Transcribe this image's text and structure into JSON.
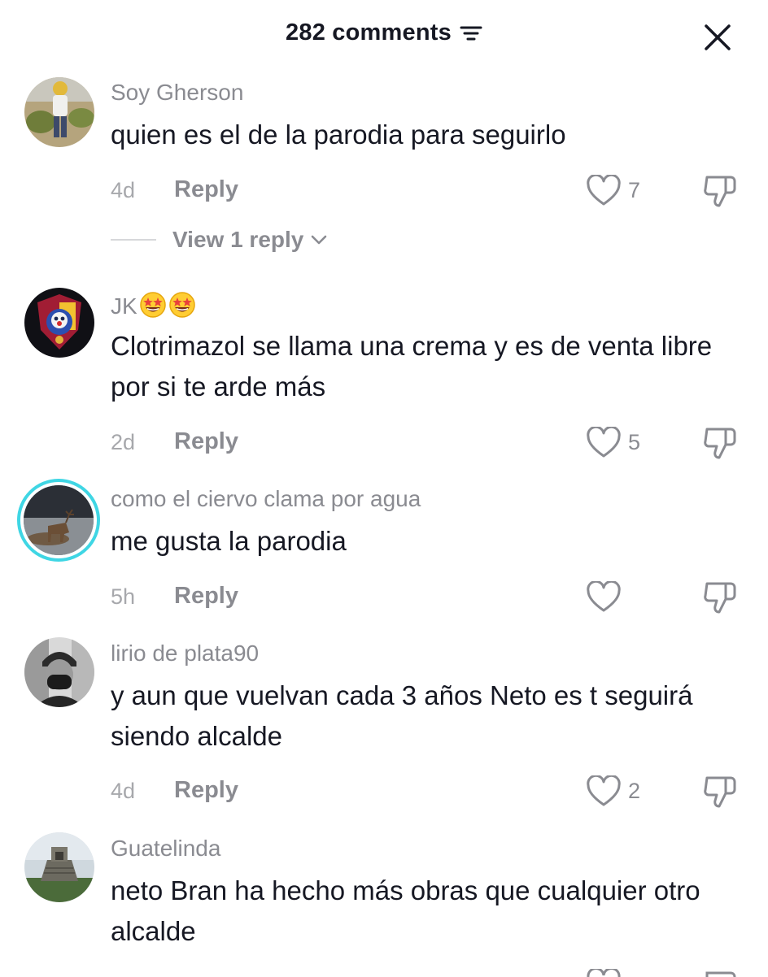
{
  "header": {
    "title": "282 comments"
  },
  "icons": {
    "sort": "sort-lines-icon",
    "close": "close-x-icon",
    "like": "heart-outline-icon",
    "dislike": "thumb-down-icon",
    "emoji": "star-struck-emoji"
  },
  "colors": {
    "text_primary": "#161823",
    "text_secondary": "#8a8b91",
    "story_ring": "#3fd6e4"
  },
  "comments": [
    {
      "username": "Soy Gherson",
      "text": "quien es el de la parodia para seguirlo",
      "time": "4d",
      "reply_label": "Reply",
      "likes": "7",
      "view_replies": "View 1 reply"
    },
    {
      "username": "JK",
      "text": "Clotrimazol se llama una crema y es de venta libre por si te arde más",
      "time": "2d",
      "reply_label": "Reply",
      "likes": "5"
    },
    {
      "username": "como el ciervo clama por agua",
      "text": "me gusta la parodia",
      "time": "5h",
      "reply_label": "Reply",
      "likes": ""
    },
    {
      "username": "lirio de plata90",
      "text": "y aun que vuelvan cada 3 años Neto es t seguirá siendo alcalde",
      "time": "4d",
      "reply_label": "Reply",
      "likes": "2"
    },
    {
      "username": "Guatelinda",
      "text": "neto Bran ha hecho más obras que cualquier otro alcalde"
    }
  ]
}
